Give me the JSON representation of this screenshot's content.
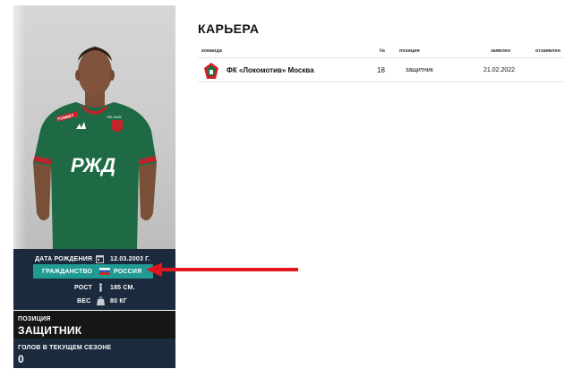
{
  "player_card": {
    "info": {
      "dob_label": "ДАТА РОЖДЕНИЯ",
      "dob_value": "12.03.2003 Г.",
      "citizenship_label": "ГРАЖДАНСТВО",
      "citizenship_value": "РОССИЯ",
      "height_label": "РОСТ",
      "height_value": "185 СМ.",
      "weight_label": "ВЕС",
      "weight_value": "80 КГ"
    },
    "position": {
      "caption": "ПОЗИЦИЯ",
      "value": "ЗАЩИТНИК"
    },
    "goals": {
      "caption": "ГОЛОВ В ТЕКУЩЕМ СЕЗОНЕ",
      "value": "0"
    },
    "icons": [
      "calendar-icon",
      "russia-flag-icon",
      "height-icon",
      "weight-icon"
    ]
  },
  "jersey": {
    "logo_text": "РЖД",
    "sponsor_left": "FONBET",
    "sponsor_right": "ТКБ БАНК"
  },
  "annotation": {
    "color": "#e3141b"
  },
  "career": {
    "title": "КАРЬЕРА",
    "columns": {
      "team": "команда",
      "number": "№",
      "position": "позиция",
      "applied": "заявлен",
      "withdrawn": "отзаявлен"
    },
    "rows": [
      {
        "team": "ФК «Локомотив» Москва",
        "number": "18",
        "position": "защитник",
        "applied": "21.02.2022",
        "withdrawn": ""
      }
    ]
  },
  "colors": {
    "navy": "#1b2a3c",
    "teal": "#1f9b94",
    "jersey_green": "#1e6a44",
    "lokomotiv_red": "#d21f26"
  }
}
